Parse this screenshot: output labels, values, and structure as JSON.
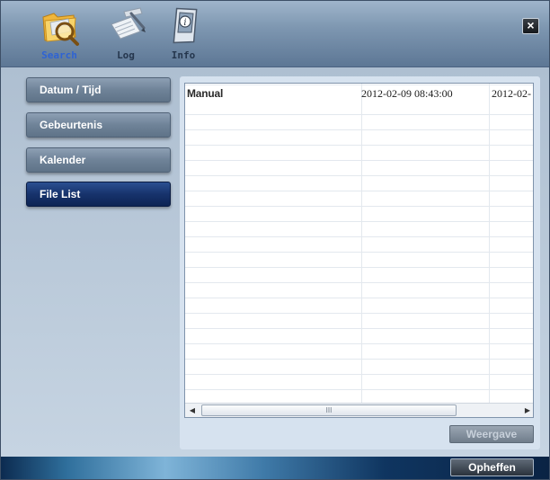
{
  "header": {
    "tabs": [
      {
        "label": "Search",
        "icon": "search-folder-icon",
        "active": true
      },
      {
        "label": "Log",
        "icon": "log-icon",
        "active": false
      },
      {
        "label": "Info",
        "icon": "info-icon",
        "active": false
      }
    ],
    "close_label": "×"
  },
  "sidebar": {
    "items": [
      {
        "label": "Datum / Tijd",
        "active": false
      },
      {
        "label": "Gebeurtenis",
        "active": false
      },
      {
        "label": "Kalender",
        "active": false
      },
      {
        "label": "File List",
        "active": true
      }
    ]
  },
  "file_list": {
    "rows": [
      {
        "type": "Manual",
        "start": "2012-02-09 08:43:00",
        "end": "2012-02-"
      }
    ],
    "scrollbar_grip": "III"
  },
  "buttons": {
    "weergave": "Weergave",
    "opheffen": "Opheffen"
  },
  "colors": {
    "active_tab_text": "#2e63d4",
    "active_sidebar": "#17336c",
    "sidebar_button": "#6f8398"
  }
}
